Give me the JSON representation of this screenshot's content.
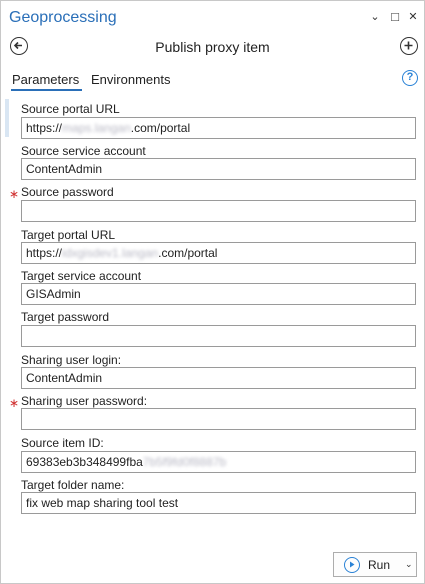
{
  "pane": {
    "title": "Geoprocessing",
    "controls": {
      "menu_glyph": "⌄",
      "maximize_glyph": "□",
      "close_glyph": "✕"
    }
  },
  "nav": {
    "title": "Publish proxy item",
    "back_icon": "back-circle-icon",
    "add_icon": "add-circle-icon"
  },
  "tabs": [
    {
      "label": "Parameters",
      "active": true
    },
    {
      "label": "Environments",
      "active": false
    }
  ],
  "help_glyph": "?",
  "required_marker": "∗",
  "fields": [
    {
      "label": "Source portal URL",
      "required": false,
      "value_prefix": "https://",
      "value_blurred": "maps.langan",
      "value_suffix": ".com/portal"
    },
    {
      "label": "Source service account",
      "required": false,
      "value": "ContentAdmin"
    },
    {
      "label": "Source password",
      "required": true,
      "value": ""
    },
    {
      "label": "Target portal URL",
      "required": false,
      "value_prefix": "https://",
      "value_blurred": "idxgisdev1.langan",
      "value_suffix": ".com/portal"
    },
    {
      "label": "Target service account",
      "required": false,
      "value": "GISAdmin"
    },
    {
      "label": "Target password",
      "required": false,
      "value": ""
    },
    {
      "label": "Sharing user login:",
      "required": false,
      "value": "ContentAdmin"
    },
    {
      "label": "Sharing user password:",
      "required": true,
      "value": ""
    },
    {
      "label": "Source item ID:",
      "required": false,
      "value_prefix": "69383eb3b348499fba",
      "value_blurred": "7b5f9fd0f8887b",
      "value_suffix": ""
    },
    {
      "label": "Target folder name:",
      "required": false,
      "value": "fix web map sharing tool test"
    }
  ],
  "run_button": {
    "label": "Run",
    "caret": "⌄"
  },
  "colors": {
    "accent": "#2a6fb8",
    "required": "#d03030",
    "help": "#2a82d6"
  }
}
